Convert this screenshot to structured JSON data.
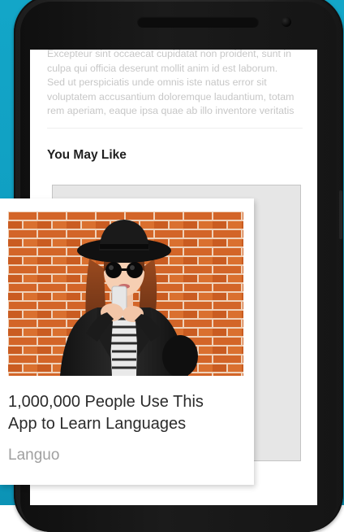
{
  "article": {
    "lines": [
      "Excepteur sint occaecat cupidatat non proident, sunt in",
      "culpa qui officia deserunt mollit anim id est laborum.",
      "Sed ut perspiciatis unde omnis iste natus error sit",
      "voluptatem accusantium doloremque laudantium, totam",
      "rem aperiam, eaque ipsa quae ab illo inventore veritatis"
    ]
  },
  "recommendations": {
    "section_title": "You May Like",
    "card": {
      "title_lines": [
        "1,000,000 People Use This",
        "App to Learn Languages"
      ],
      "source": "Languo",
      "image_alt": "Woman in black hat and sunglasses using a smartphone in front of a brick wall"
    }
  },
  "colors": {
    "background": "#13a6c8",
    "phone_body": "#222222",
    "brick": "#c95d24"
  }
}
